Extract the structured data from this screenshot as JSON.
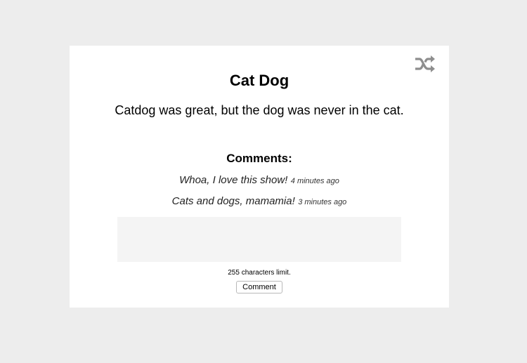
{
  "post": {
    "title": "Cat Dog",
    "body": "Catdog was great, but the dog was never in the cat."
  },
  "comments": {
    "heading": "Comments:",
    "items": [
      {
        "text": "Whoa, I love this show!",
        "time": "4 minutes ago"
      },
      {
        "text": "Cats and dogs, mamamia!",
        "time": "3 minutes ago"
      }
    ]
  },
  "form": {
    "textarea_value": "",
    "limit_text": "255 characters limit.",
    "submit_label": "Comment"
  },
  "icons": {
    "shuffle": "shuffle-icon"
  },
  "colors": {
    "page_background": "#ededed",
    "card_background": "#ffffff",
    "icon_color": "#8e8e8e",
    "textarea_background": "#f4f4f4"
  }
}
